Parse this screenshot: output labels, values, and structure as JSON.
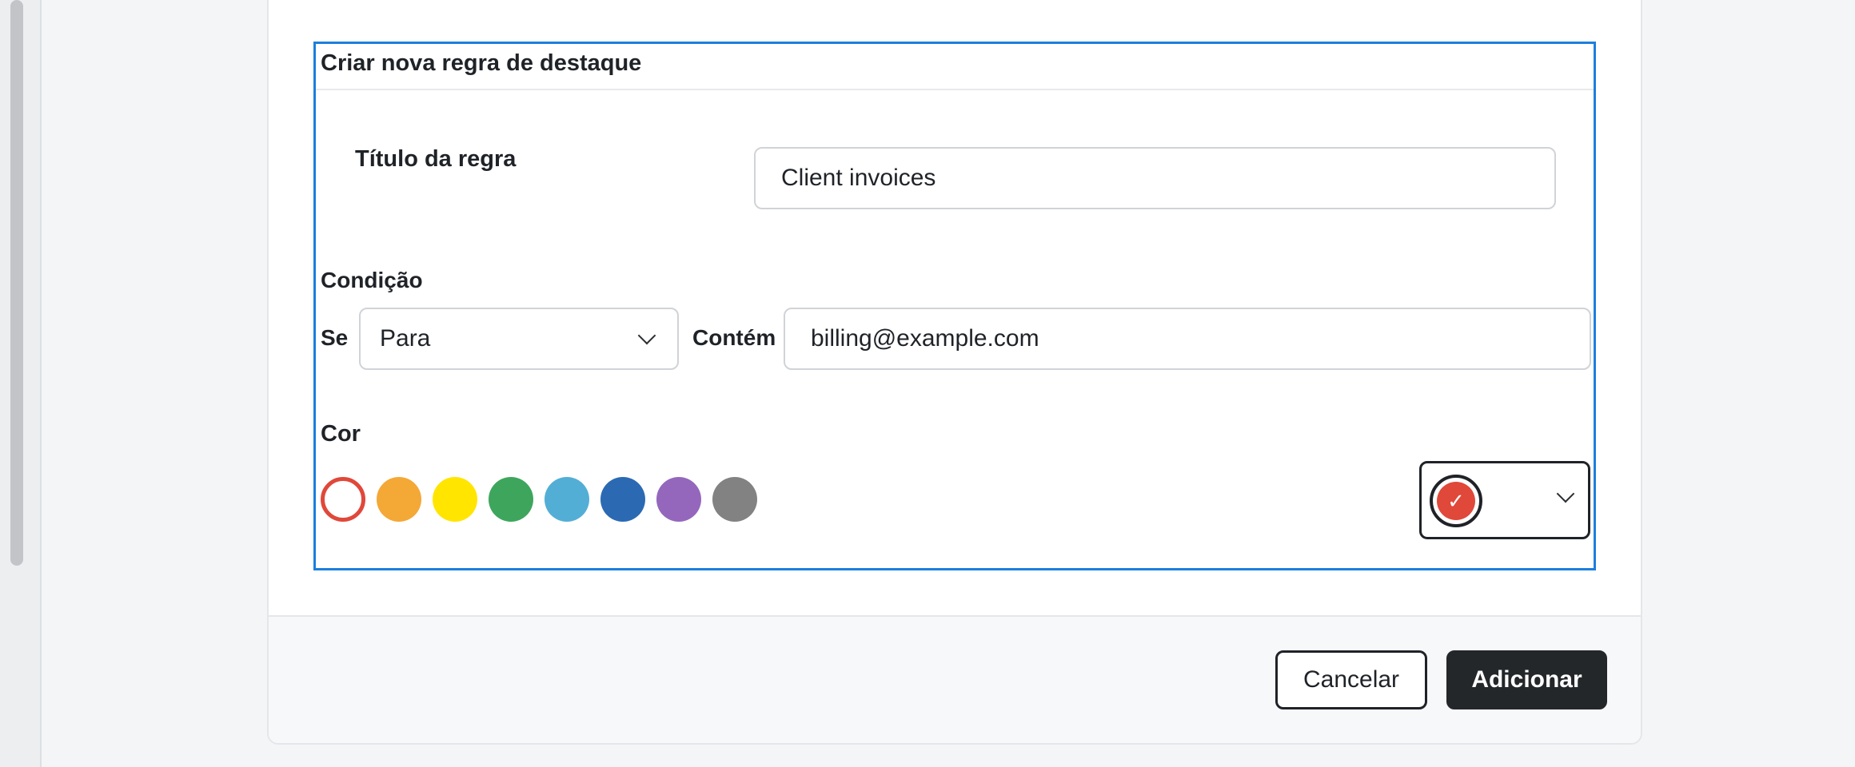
{
  "form": {
    "heading": "Criar nova regra de destaque",
    "title_label": "Título da regra",
    "title_value": "Client invoices",
    "condition_label": "Condição",
    "if_label": "Se",
    "field_select_value": "Para",
    "contains_label": "Contém",
    "contains_value": "billing@example.com",
    "color_label": "Cor",
    "swatches": [
      {
        "name": "red",
        "hex": "#e0483a",
        "selected": true
      },
      {
        "name": "orange",
        "hex": "#f4a836",
        "selected": false
      },
      {
        "name": "yellow",
        "hex": "#ffe500",
        "selected": false
      },
      {
        "name": "green",
        "hex": "#3ea65c",
        "selected": false
      },
      {
        "name": "light-blue",
        "hex": "#53aed6",
        "selected": false
      },
      {
        "name": "blue",
        "hex": "#2b6ab3",
        "selected": false
      },
      {
        "name": "purple",
        "hex": "#9467bd",
        "selected": false
      },
      {
        "name": "gray",
        "hex": "#828282",
        "selected": false
      }
    ],
    "picker_icon": "check-icon"
  },
  "footer": {
    "cancel_label": "Cancelar",
    "add_label": "Adicionar"
  },
  "colors": {
    "accent_focus": "#1b7fdc",
    "primary_button": "#24272a"
  }
}
